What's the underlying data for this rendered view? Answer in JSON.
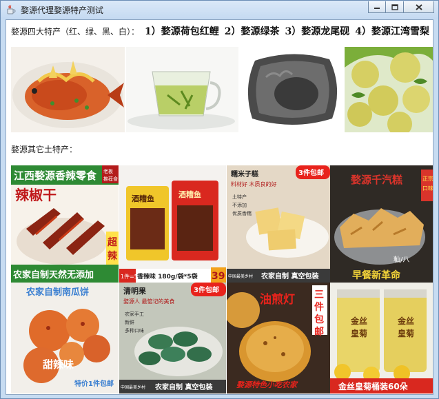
{
  "window": {
    "title": "婺源代理婺源特产测试",
    "icon": "java-cup-icon",
    "buttons": [
      "minimize-icon",
      "maximize-icon",
      "close-icon"
    ]
  },
  "main": {
    "intro_label": "婺源四大特产（红、绿、黑、白）：",
    "four_specialties": [
      "1）婺源荷包红鲤",
      "2）婺源绿茶",
      "3）婺源龙尾砚",
      "4）婺源江湾雪梨"
    ],
    "other_label": "婺源其它土特产："
  },
  "products": [
    {
      "banner": "江西婺源香辣零食",
      "tag": "老板\n推荐食",
      "title": "辣椒干",
      "footer": "农家自制天然无添加",
      "side": "超辣"
    },
    {
      "pkg": "酒糟鱼",
      "footer_left": "1件=5袋",
      "footer_mid": "香辣味 180g/袋*5袋",
      "price": "39"
    },
    {
      "tag": "糯米子糕",
      "sub": "料材好 木质良的好",
      "checks": [
        "土特产",
        "不添加",
        "优质香糯"
      ],
      "badge": "3件包邮",
      "brand": "中国最美乡村",
      "footer": "农家自制  真空包装"
    },
    {
      "title": "婺源千汽糕",
      "side": "正宗口味",
      "side2": "籼/八",
      "footer": "早餐新革命"
    },
    {
      "title": "农家自制南瓜饼",
      "flavor": "甜辣味",
      "promo": "特价1件包邮"
    },
    {
      "tag": "清明果",
      "sub": "婺源人 最惦记的美食",
      "checks": [
        "农家手工",
        "新鲜",
        "多种口味"
      ],
      "badge": "3件包邮",
      "brand": "中国最美乡村",
      "footer": "农家自制  真空包装"
    },
    {
      "title": "油煎灯",
      "side": "三件包邮",
      "footer": "婺源特色小吃农家"
    },
    {
      "jar": "金丝皇菊",
      "footer": "金丝皇菊桶装60朵"
    }
  ]
}
